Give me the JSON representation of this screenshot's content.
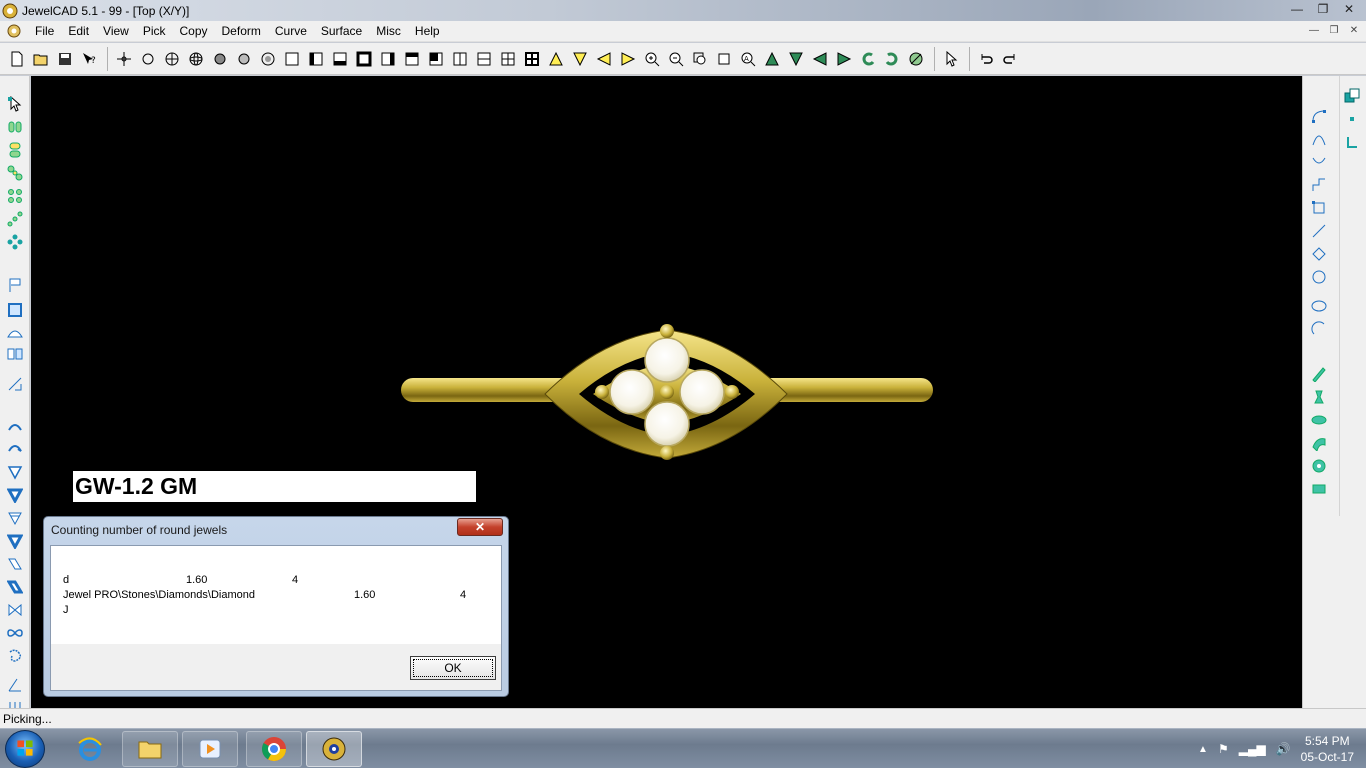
{
  "window": {
    "title": "JewelCAD 5.1 - 99 - [Top (X/Y)]",
    "minimize": "—",
    "maximize": "❐",
    "close": "✕"
  },
  "menu": {
    "items": [
      "File",
      "Edit",
      "View",
      "Pick",
      "Copy",
      "Deform",
      "Curve",
      "Surface",
      "Misc",
      "Help"
    ]
  },
  "viewport": {
    "label": "GW-1.2 GM",
    "background": "#000000",
    "metal_color": "#c9b13a"
  },
  "dialog": {
    "title": "Counting number of round jewels",
    "close_label": "✕",
    "rows": [
      {
        "name": "d",
        "size": "1.60",
        "count": "4"
      },
      {
        "name": "Jewel PRO\\Stones\\Diamonds\\Diamond",
        "size": "1.60",
        "count": "4"
      },
      {
        "name": "J",
        "size": "",
        "count": ""
      }
    ],
    "ok_label": "OK"
  },
  "status": {
    "text": "Picking..."
  },
  "taskbar": {
    "time": "5:54 PM",
    "date": "05-Oct-17"
  },
  "colors": {
    "accent_green": "#2e8b57",
    "accent_blue": "#1f6fc1",
    "teal": "#1aa3a3"
  }
}
